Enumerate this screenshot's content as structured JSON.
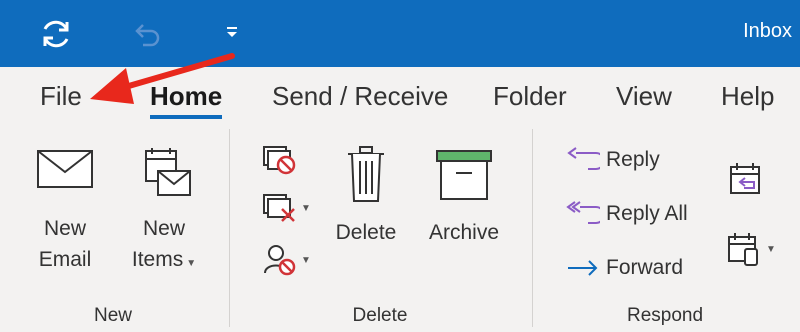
{
  "window": {
    "title": "Inbox"
  },
  "quick_access": {
    "sync_icon": "sync-icon",
    "undo_icon": "undo-icon",
    "customize_icon": "chevron-down-icon"
  },
  "tabs": [
    {
      "label": "File",
      "active": false
    },
    {
      "label": "Home",
      "active": true
    },
    {
      "label": "Send / Receive",
      "active": false
    },
    {
      "label": "Folder",
      "active": false
    },
    {
      "label": "View",
      "active": false
    },
    {
      "label": "Help",
      "active": false
    }
  ],
  "groups": {
    "new": {
      "label": "New",
      "new_email": {
        "line1": "New",
        "line2": "Email"
      },
      "new_items": {
        "line1": "New",
        "line2": "Items"
      }
    },
    "delete": {
      "label": "Delete",
      "delete_label": "Delete",
      "archive_label": "Archive"
    },
    "respond": {
      "label": "Respond",
      "reply": "Reply",
      "reply_all": "Reply All",
      "forward": "Forward"
    }
  },
  "colors": {
    "accent": "#0f6cbd",
    "annotation_arrow": "#e8281c",
    "archive_green": "#5fb46b",
    "ignore_red": "#d13438",
    "reply_purple": "#8b5cc6"
  }
}
